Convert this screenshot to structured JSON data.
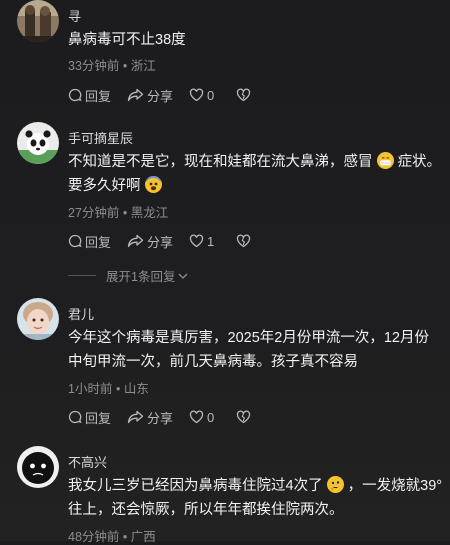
{
  "comments": [
    {
      "username": "寻",
      "text": "鼻病毒可不止38度",
      "time": "33分钟前",
      "location": "浙江",
      "reply_label": "回复",
      "share_label": "分享",
      "likes": "0"
    },
    {
      "username": "手可摘星辰",
      "text_a": "不知道是不是它，现在和娃都在流大鼻涕，感冒",
      "text_b": "症状。",
      "text_c": "要多久好啊",
      "time": "27分钟前",
      "location": "黑龙江",
      "reply_label": "回复",
      "share_label": "分享",
      "likes": "1"
    },
    {
      "username": "君儿",
      "text": "今年这个病毒是真厉害，2025年2月份甲流一次，12月份中旬甲流一次，前几天鼻病毒。孩子真不容易",
      "time": "1小时前",
      "location": "山东",
      "reply_label": "回复",
      "share_label": "分享",
      "likes": "0"
    },
    {
      "username": "不高兴",
      "text_a": "我女儿三岁已经因为鼻病毒住院过4次了",
      "text_b": "，一发烧就39°往上，还会惊厥，所以年年都挨住院两次。",
      "time": "48分钟前",
      "location": "广西"
    }
  ],
  "expand_replies": "展开1条回复",
  "meta_separator": "•",
  "colors": {
    "background": "#1c1c1e",
    "text_primary": "#f2f2f3",
    "text_secondary": "#8d8d92",
    "emoji_yellow": "#f4c430"
  }
}
